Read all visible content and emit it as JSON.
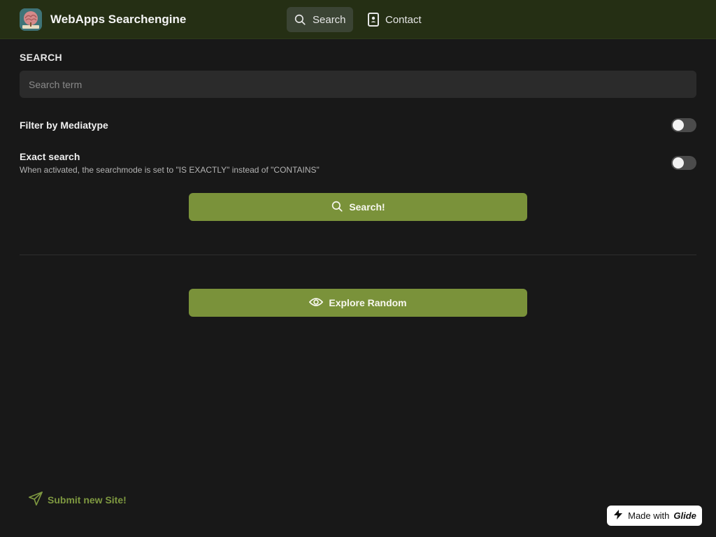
{
  "header": {
    "app_title": "WebApps Searchengine",
    "tabs": [
      {
        "label": "Search",
        "icon": "search-icon",
        "active": true
      },
      {
        "label": "Contact",
        "icon": "contact-card-icon",
        "active": false
      }
    ]
  },
  "search": {
    "section_label": "SEARCH",
    "placeholder": "Search term",
    "value": ""
  },
  "filters": {
    "mediatype": {
      "label": "Filter by Mediatype",
      "on": false
    },
    "exact": {
      "label": "Exact search",
      "description": "When activated, the searchmode is set to \"IS EXACTLY\" instead of \"CONTAINS\"",
      "on": false
    }
  },
  "actions": {
    "search_label": "Search!",
    "explore_label": "Explore Random"
  },
  "footer": {
    "submit_label": "Submit new Site!",
    "badge_prefix": "Made with",
    "badge_brand": "Glide"
  },
  "colors": {
    "accent": "#7a923a",
    "topbar": "#252f14",
    "background": "#181818"
  }
}
